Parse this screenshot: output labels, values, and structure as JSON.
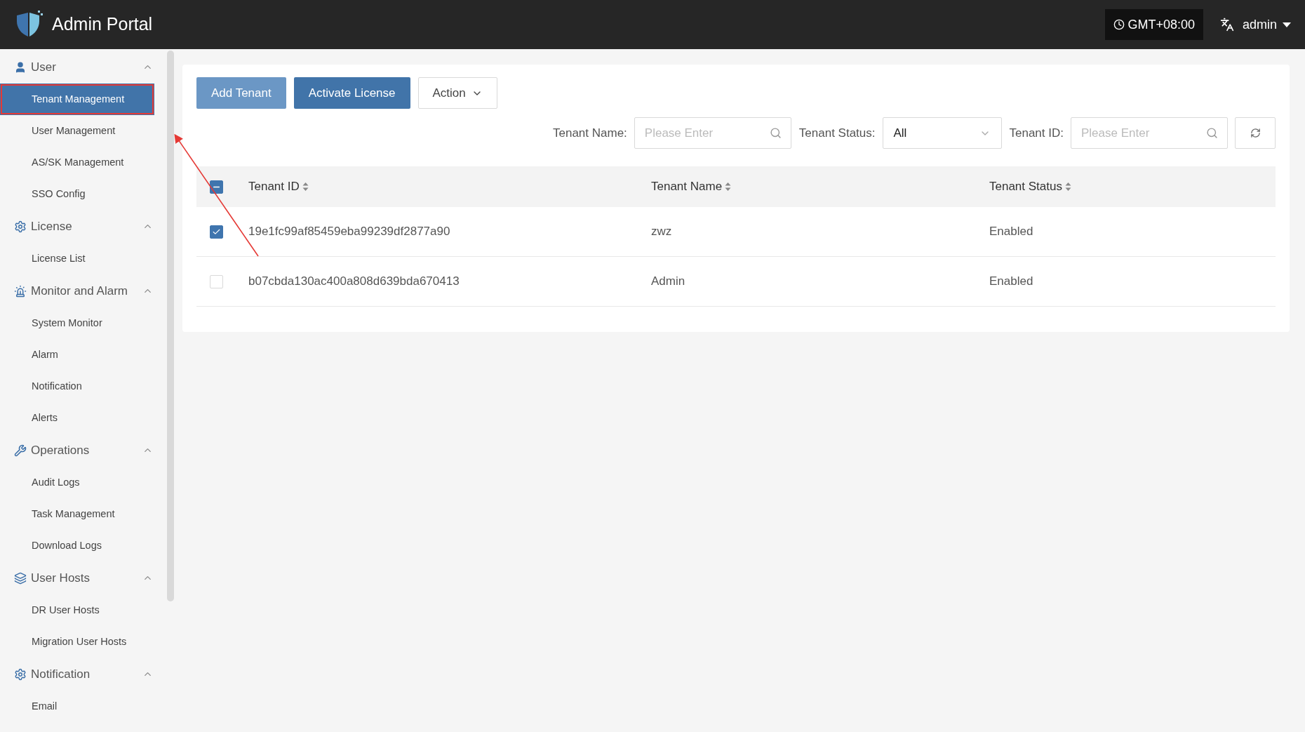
{
  "header": {
    "title": "Admin Portal",
    "timezone": "GMT+08:00",
    "user": "admin"
  },
  "sidebar": {
    "groups": [
      {
        "label": "User",
        "expanded": true,
        "items": [
          {
            "label": "Tenant Management",
            "selected": true,
            "outlined": true
          },
          {
            "label": "User Management",
            "selected": false,
            "outlined": false
          },
          {
            "label": "AS/SK Management",
            "selected": false,
            "outlined": false
          },
          {
            "label": "SSO Config",
            "selected": false,
            "outlined": false
          }
        ]
      },
      {
        "label": "License",
        "expanded": true,
        "items": [
          {
            "label": "License List",
            "selected": false,
            "outlined": false
          }
        ]
      },
      {
        "label": "Monitor and Alarm",
        "expanded": true,
        "items": [
          {
            "label": "System Monitor",
            "selected": false,
            "outlined": false
          },
          {
            "label": "Alarm",
            "selected": false,
            "outlined": false
          },
          {
            "label": "Notification",
            "selected": false,
            "outlined": false
          },
          {
            "label": "Alerts",
            "selected": false,
            "outlined": false
          }
        ]
      },
      {
        "label": "Operations",
        "expanded": true,
        "items": [
          {
            "label": "Audit Logs",
            "selected": false,
            "outlined": false
          },
          {
            "label": "Task Management",
            "selected": false,
            "outlined": false
          },
          {
            "label": "Download Logs",
            "selected": false,
            "outlined": false
          }
        ]
      },
      {
        "label": "User Hosts",
        "expanded": true,
        "items": [
          {
            "label": "DR User Hosts",
            "selected": false,
            "outlined": false
          },
          {
            "label": "Migration User Hosts",
            "selected": false,
            "outlined": false
          }
        ]
      },
      {
        "label": "Notification",
        "expanded": true,
        "items": [
          {
            "label": "Email",
            "selected": false,
            "outlined": false
          }
        ]
      }
    ]
  },
  "toolbar": {
    "buttons": [
      {
        "label": "Add Tenant",
        "kind": "primary",
        "disabled": true
      },
      {
        "label": "Activate License",
        "kind": "primary",
        "disabled": false
      },
      {
        "label": "Action",
        "kind": "dropdown",
        "disabled": false
      }
    ]
  },
  "filters": [
    {
      "label": "Tenant Name:",
      "kind": "search",
      "placeholder": "Please Enter"
    },
    {
      "label": "Tenant Status:",
      "kind": "select",
      "value": "All"
    },
    {
      "label": "Tenant ID:",
      "kind": "search",
      "placeholder": "Please Enter"
    }
  ],
  "table": {
    "select_all_indeterminate": true,
    "columns": [
      "Tenant ID",
      "Tenant Name",
      "Tenant Status"
    ],
    "rows": [
      {
        "checked": true,
        "cells": [
          "19e1fc99af85459eba99239df2877a90",
          "zwz",
          "Enabled"
        ]
      },
      {
        "checked": false,
        "cells": [
          "b07cbda130ac400a808d639bda670413",
          "Admin",
          "Enabled"
        ]
      }
    ]
  },
  "annotation": {
    "arrow": true
  }
}
